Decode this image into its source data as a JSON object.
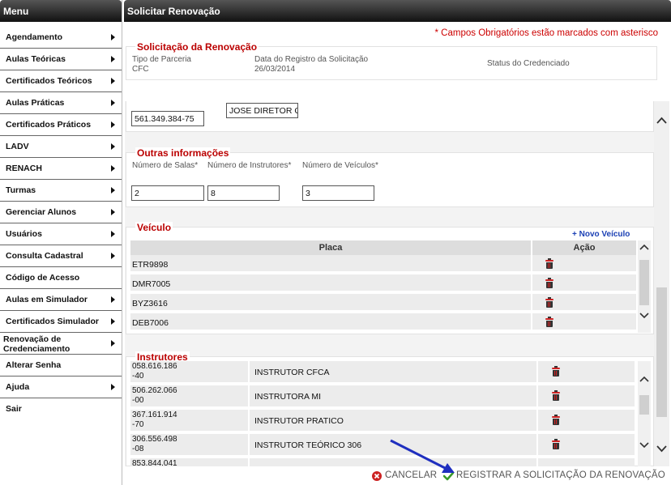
{
  "sidebar": {
    "title": "Menu",
    "items": [
      {
        "label": "Agendamento",
        "arrow": true
      },
      {
        "label": "Aulas Teóricas",
        "arrow": true
      },
      {
        "label": "Certificados Teóricos",
        "arrow": true
      },
      {
        "label": "Aulas Práticas",
        "arrow": true
      },
      {
        "label": "Certificados Práticos",
        "arrow": true
      },
      {
        "label": "LADV",
        "arrow": true
      },
      {
        "label": "RENACH",
        "arrow": true
      },
      {
        "label": "Turmas",
        "arrow": true
      },
      {
        "label": "Gerenciar Alunos",
        "arrow": true
      },
      {
        "label": "Usuários",
        "arrow": true
      },
      {
        "label": "Consulta Cadastral",
        "arrow": true
      },
      {
        "label": "Código de Acesso",
        "arrow": false
      },
      {
        "label": "Aulas em Simulador",
        "arrow": true
      },
      {
        "label": "Certificados Simulador",
        "arrow": true
      },
      {
        "label": "Renovação de Credenciamento",
        "arrow": true
      },
      {
        "label": "Alterar Senha",
        "arrow": false
      },
      {
        "label": "Ajuda",
        "arrow": true
      },
      {
        "label": "Sair",
        "arrow": false
      }
    ]
  },
  "main": {
    "title": "Solicitar Renovação",
    "required_note": "* Campos Obrigatórios estão marcados com asterisco"
  },
  "solicitacao": {
    "legend": "Solicitação da Renovação",
    "tipo_label": "Tipo de Parceria",
    "tipo_value": "CFC",
    "data_label": "Data do Registro da Solicitação",
    "data_value": "26/03/2014",
    "status_label": "Status do Credenciado"
  },
  "diretor": {
    "cpf": "561.349.384-75",
    "nome": "JOSE DIRETOR  C"
  },
  "outras": {
    "legend": "Outras informações",
    "salas_label": "Número de Salas*",
    "instrutores_label": "Número de Instrutores*",
    "veiculos_label": "Número de Veículos*",
    "salas_value": "2",
    "instrutores_value": "8",
    "veiculos_value": "3"
  },
  "veiculo": {
    "legend": "Veículo",
    "novo_label": "+ Novo Veículo",
    "col_placa": "Placa",
    "col_acao": "Ação",
    "rows": [
      {
        "placa": "ETR9898"
      },
      {
        "placa": "DMR7005"
      },
      {
        "placa": "BYZ3616"
      },
      {
        "placa": "DEB7006"
      }
    ]
  },
  "instrutores": {
    "legend": "Instrutores",
    "rows": [
      {
        "cpf1": "058.616.186",
        "cpf2": "-40",
        "nome": "INSTRUTOR CFCA"
      },
      {
        "cpf1": "506.262.066",
        "cpf2": "-00",
        "nome": "INSTRUTORA MI"
      },
      {
        "cpf1": "367.161.914",
        "cpf2": "-70",
        "nome": "INSTRUTOR PRATICO"
      },
      {
        "cpf1": "306.556.498",
        "cpf2": "-08",
        "nome": "INSTRUTOR TEÓRICO 306"
      },
      {
        "cpf1": "853.844.041",
        "cpf2": "",
        "nome": ""
      }
    ]
  },
  "actions": {
    "cancel_label": "CANCELAR",
    "submit_label": "REGISTRAR A SOLICITAÇÃO DA RENOVAÇÃO"
  },
  "colors": {
    "legend_red": "#b00000",
    "link_blue": "#1a3fb4",
    "cancel_red": "#cc2222",
    "check_green": "#3a9a2a",
    "annotation_arrow": "#1f2fbf"
  }
}
